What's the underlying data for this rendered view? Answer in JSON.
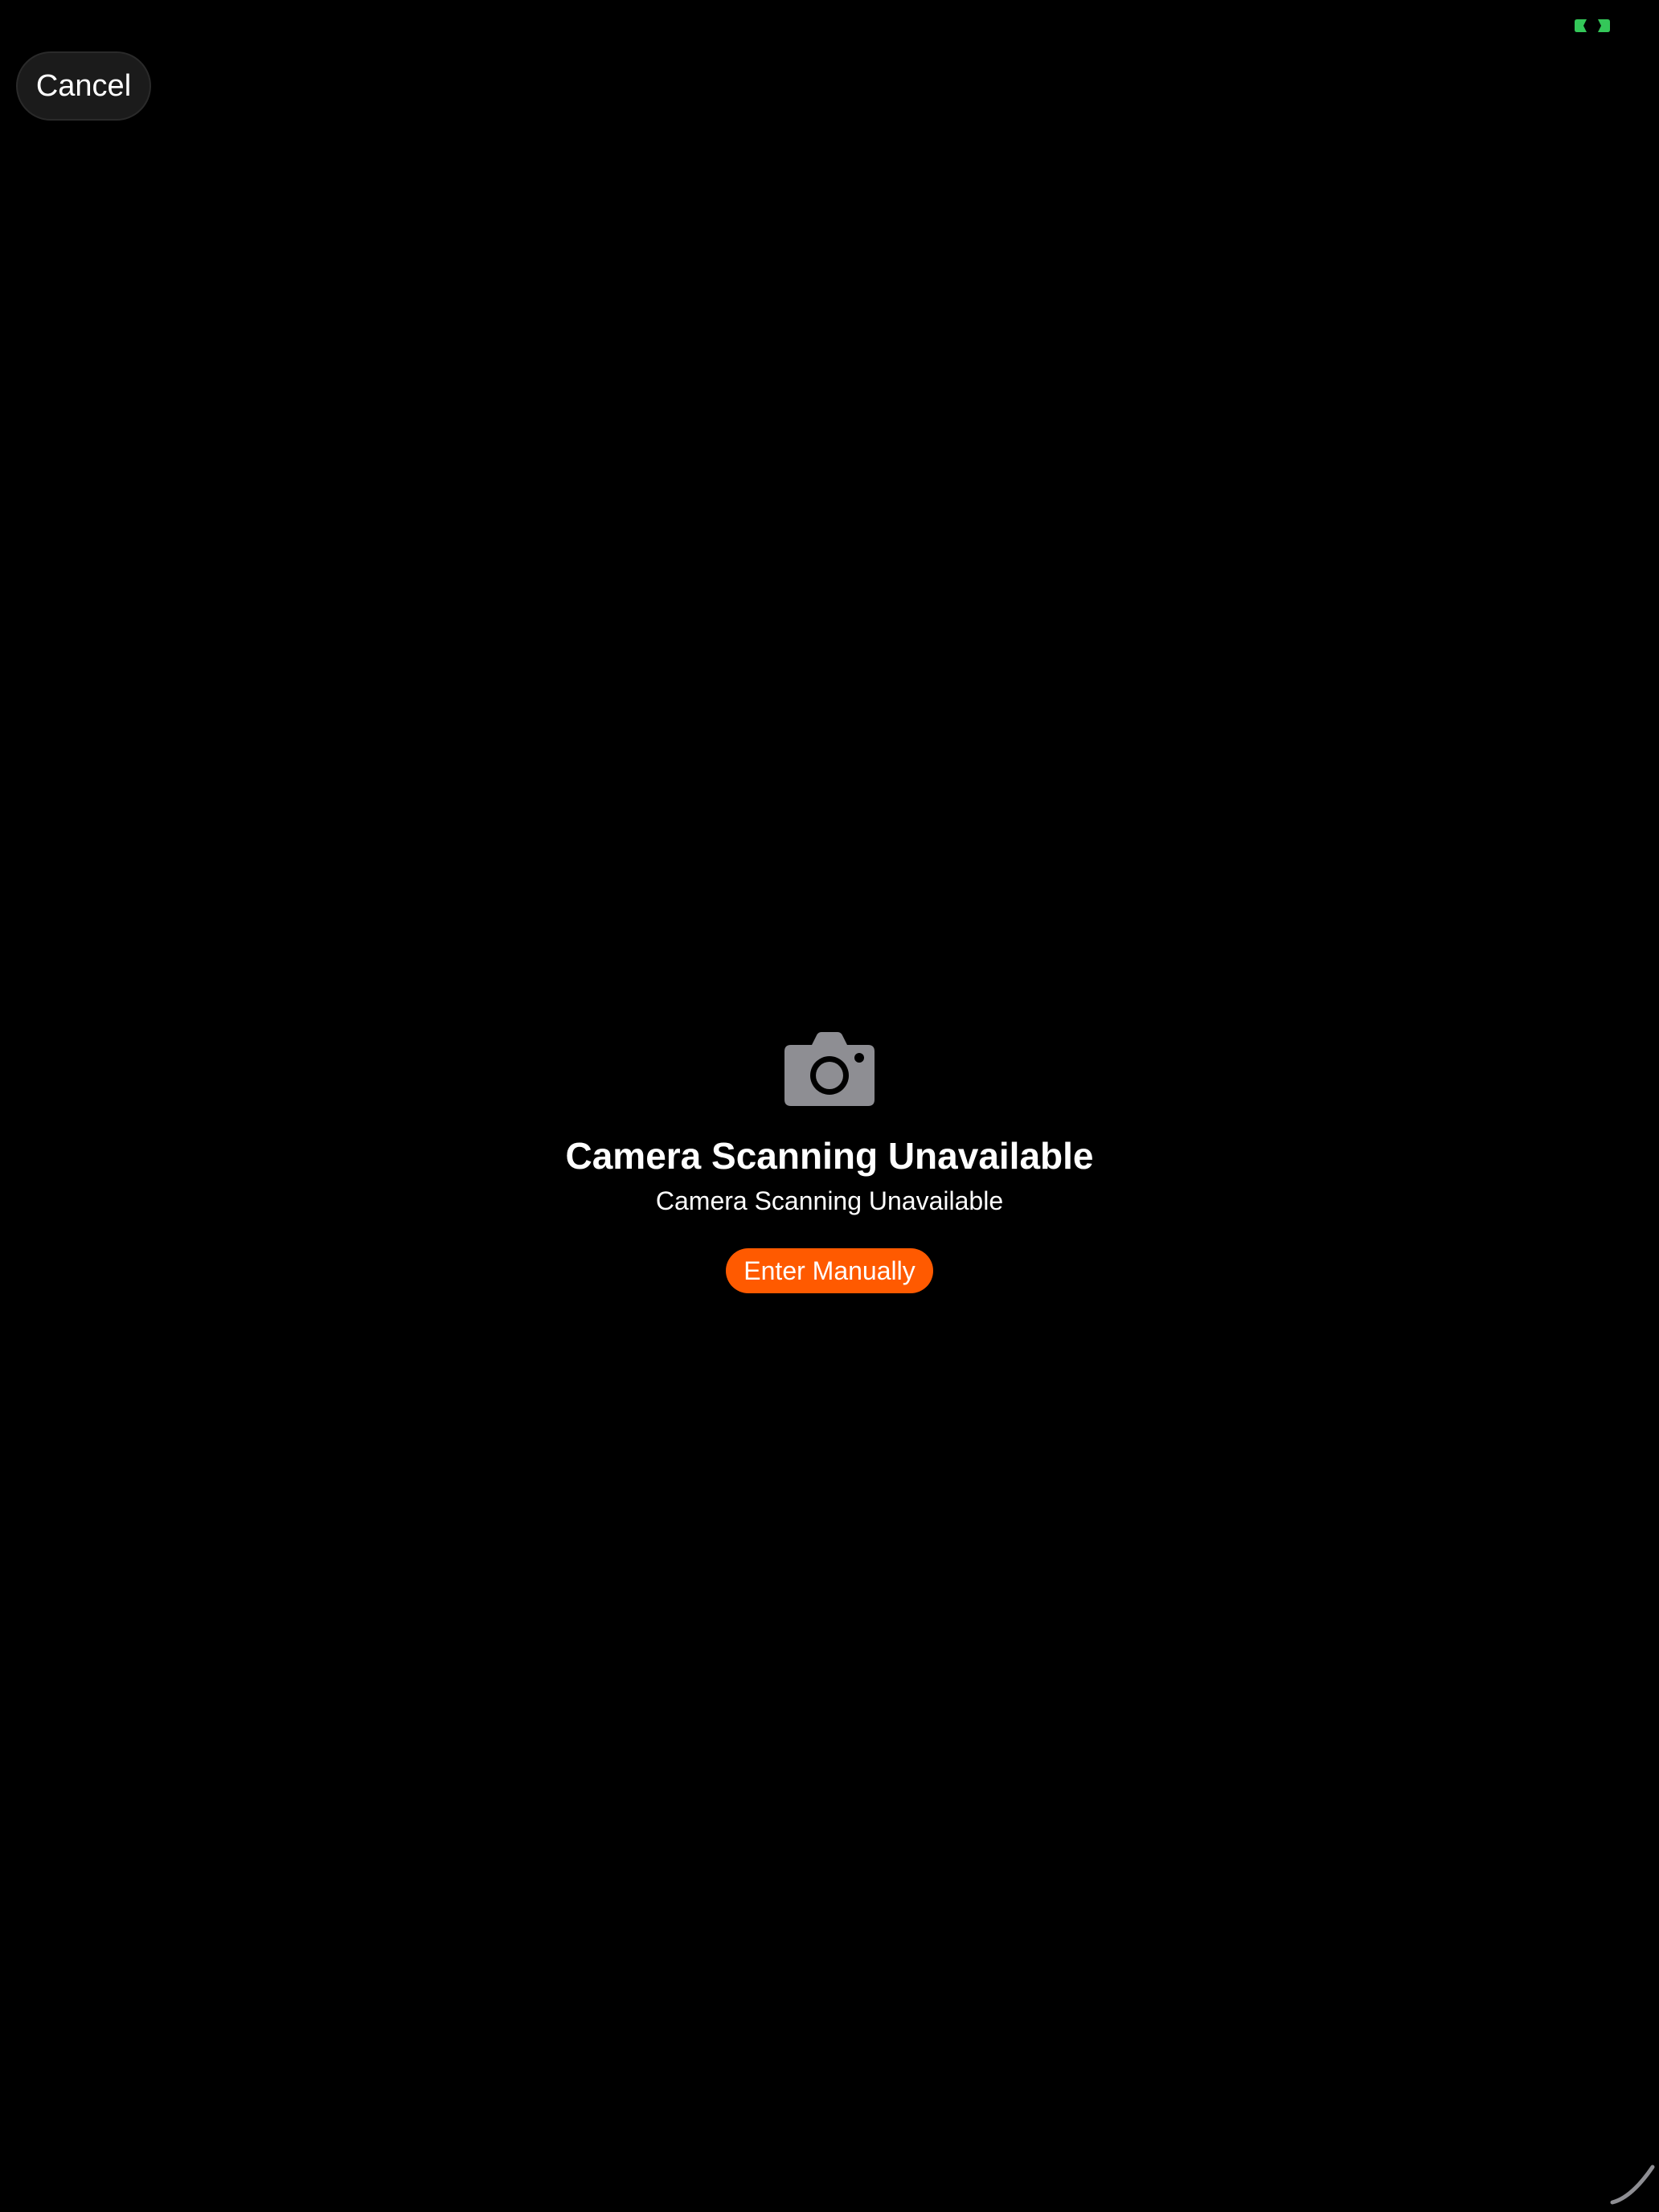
{
  "header": {
    "cancel_label": "Cancel",
    "status_indicator_icon": "screen-sharing-indicator-icon",
    "status_indicator_color": "#34c759"
  },
  "main": {
    "icon": "camera-icon",
    "icon_color": "#8e8e93",
    "title": "Camera Scanning Unavailable",
    "subtitle": "Camera Scanning Unavailable",
    "enter_manually_label": "Enter Manually",
    "accent_color": "#ff5a00"
  },
  "footer": {
    "resize_handle_icon": "resize-handle-icon"
  }
}
